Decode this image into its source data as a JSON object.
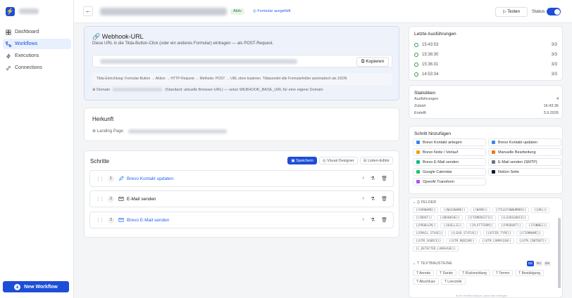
{
  "sidebar": {
    "logo_letter": "⚡",
    "items": [
      {
        "label": "Dashboard",
        "icon": "grid-icon",
        "active": false
      },
      {
        "label": "Workflows",
        "icon": "flow-icon",
        "active": true
      },
      {
        "label": "Executions",
        "icon": "bolt-icon",
        "active": false
      },
      {
        "label": "Connections",
        "icon": "link-icon",
        "active": false
      }
    ],
    "new_workflow": "New Workflow"
  },
  "topbar": {
    "badge_active": "Aktiv",
    "badge_form": "Formular ausgefüllt",
    "test_label": "Testen",
    "status_label": "Status",
    "status_on": true
  },
  "webhook": {
    "title": "Webhook-URL",
    "description": "Diese URL in die Tilda-Button-Click (oder ein anderes Formular) eintragen — als POST-Request.",
    "copy_label": "Kopieren",
    "hint": "Tilda-Einrichtung: Formular-Button → Aktion → HTTP-Request → Methode: POST → URL oben kopieren. Tildasendet alle Formularfelder automatisch als JSON",
    "domain_label": "Domain",
    "domain_note": "(Standard: aktuelle Browser-URL) — setze WEBHOOK_BASE_URL für eine eigene Domain"
  },
  "herkunft": {
    "title": "Herkunft",
    "landing_label": "Landing Page:"
  },
  "schritte": {
    "title": "Schritte",
    "save": "Speichern",
    "visual": "Visual Designer",
    "list": "Listen-Editor",
    "steps": [
      {
        "num": "1",
        "label": "Brevo Kontakt updaten",
        "link": true
      },
      {
        "num": "2",
        "label": "E-Mail senden",
        "link": false
      },
      {
        "num": "3",
        "label": "Brevo E-Mail senden",
        "link": true
      }
    ]
  },
  "last_runs": {
    "title": "Letzte Ausführungen",
    "runs": [
      {
        "time": "15:43:53",
        "count": "3/3"
      },
      {
        "time": "15:38:30",
        "count": "3/3"
      },
      {
        "time": "15:36:31",
        "count": "3/3"
      },
      {
        "time": "14:53:34",
        "count": "3/3"
      }
    ]
  },
  "stats": {
    "title": "Statistiken",
    "rows": [
      {
        "label": "Ausführungen",
        "value": "4"
      },
      {
        "label": "Zuletzt",
        "value": "16:43:36"
      },
      {
        "label": "Erstellt",
        "value": "3.9.2026"
      }
    ]
  },
  "add_step": {
    "title": "Schritt hinzufügen",
    "items": [
      {
        "label": "Brevo Kontakt anlegen",
        "color": "#3b82f6"
      },
      {
        "label": "Brevo Kontakt updaten",
        "color": "#3b82f6"
      },
      {
        "label": "Brevo Notiz / Verlauf",
        "color": "#f59e0b"
      },
      {
        "label": "Manuelle Bearbeitung",
        "color": "#f97316"
      },
      {
        "label": "Brevo E-Mail senden",
        "color": "#10b981"
      },
      {
        "label": "E-Mail senden (SMTP)",
        "color": "#64748b"
      },
      {
        "label": "Google Calendar",
        "color": "#22c55e"
      },
      {
        "label": "Notion Seite",
        "color": "#111827"
      },
      {
        "label": "OpenAI Transform",
        "color": "#a855f7"
      }
    ]
  },
  "fields": {
    "title": "FELDER",
    "chips": [
      "{{VORNAME}}",
      "{{NACHNAME}}",
      "{{NAME}}",
      "{{TELEFONNUMMER}}",
      "{{URL}}",
      "{{INPUT}}",
      "{{BRANCHE}}",
      "{{FIRMENSITZ}}",
      "{{LEADSOURCE}}",
      "{{PROBLEM}}",
      "{{QUELLE}}",
      "{{PLATTFORM}}",
      "{{PRODUKT}}",
      "{{FUNNEL}}",
      "{{EMAIL_STAGE}}",
      "{{LEAD_STATUS}}",
      "{{OFFER_TYPE}}",
      "{{FIRMNAME}}",
      "{{UTM_SOURCE}}",
      "{{UTM_MEDIUM}}",
      "{{UTM_CAMPAIGN}}",
      "{{UTM_CONTENT}}",
      "{{_DETECTED_LANGUAGE}}"
    ],
    "text_title": "TEXTBAUSTEINE",
    "langs": [
      "DE",
      "RU",
      "EN"
    ],
    "text_chips": [
      "Anrede",
      "Danke",
      "Rückmeldung",
      "Termin",
      "Bestätigung",
      "Abschluss",
      "Leerzeile"
    ],
    "footer": "In ein Textfeld klicken, dann hier einfügen"
  }
}
